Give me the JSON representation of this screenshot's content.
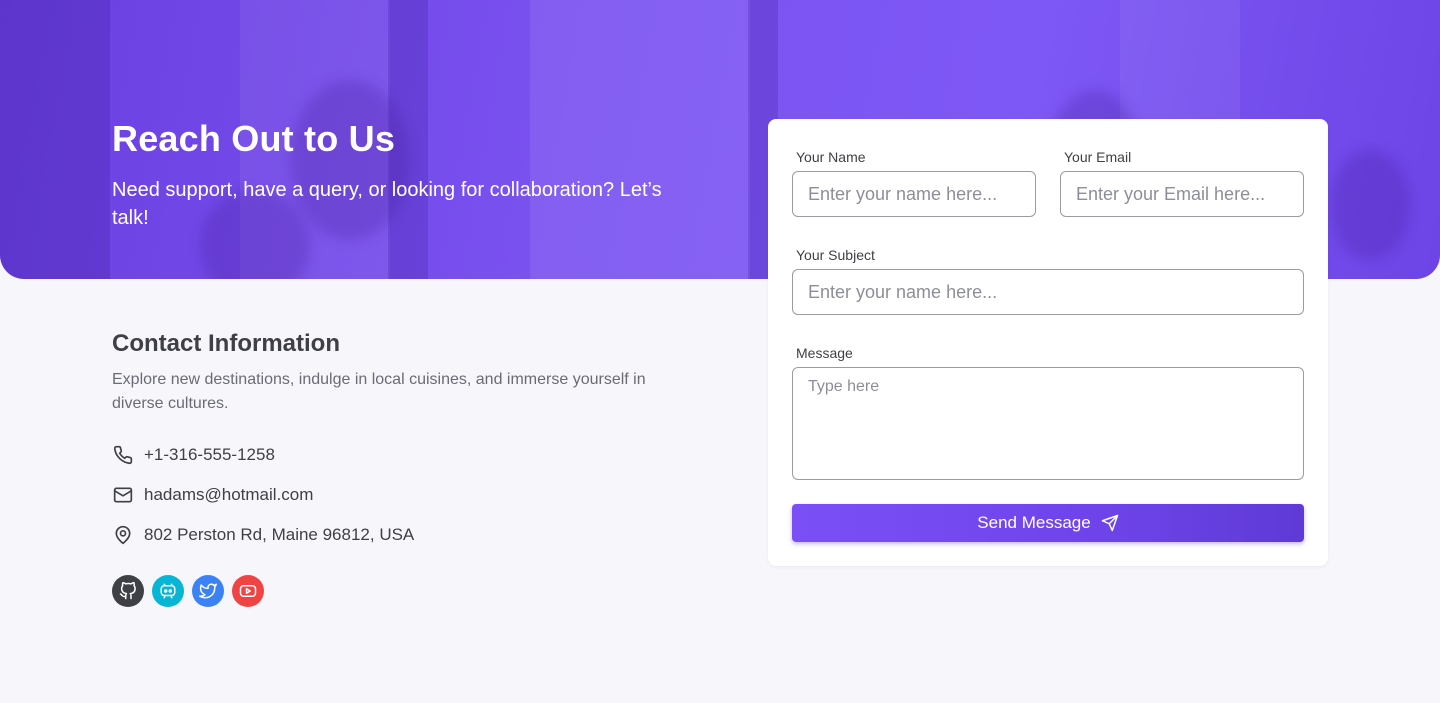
{
  "hero": {
    "title": "Reach Out to Us",
    "subtitle": "Need support, have a query, or looking for collaboration? Let’s talk!"
  },
  "contact": {
    "title": "Contact Information",
    "description": "Explore new destinations, indulge in local cuisines, and immerse yourself in diverse cultures.",
    "phone": "+1-316-555-1258",
    "email": "hadams@hotmail.com",
    "address": "802 Perston Rd, Maine 96812, USA",
    "icons": {
      "phone": "phone-icon",
      "email": "mail-icon",
      "address": "map-pin-icon"
    }
  },
  "socials": [
    {
      "name": "github",
      "icon": "github-icon",
      "color": "#3f3f46"
    },
    {
      "name": "discord",
      "icon": "discord-icon",
      "color": "#06b6d4"
    },
    {
      "name": "twitter",
      "icon": "twitter-icon",
      "color": "#3b82f6"
    },
    {
      "name": "youtube",
      "icon": "youtube-icon",
      "color": "#ef4444"
    }
  ],
  "form": {
    "name_label": "Your Name",
    "name_placeholder": "Enter your name here...",
    "email_label": "Your Email",
    "email_placeholder": "Enter your Email here...",
    "subject_label": "Your Subject",
    "subject_placeholder": "Enter your name here...",
    "message_label": "Message",
    "message_placeholder": "Type here",
    "submit_label": "Send Message"
  },
  "colors": {
    "accent": "#7b4ff6",
    "background": "#f7f6fb"
  }
}
